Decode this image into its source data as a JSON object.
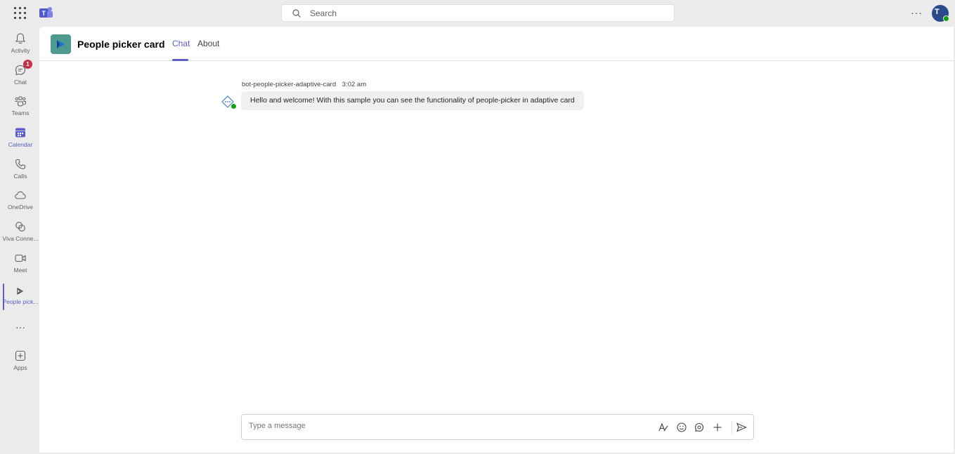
{
  "search": {
    "placeholder": "Search"
  },
  "topbar": {
    "more_label": "···",
    "avatar_initial": "T"
  },
  "rail": {
    "items": [
      {
        "label": "Activity"
      },
      {
        "label": "Chat",
        "badge": "1"
      },
      {
        "label": "Teams"
      },
      {
        "label": "Calendar"
      },
      {
        "label": "Calls"
      },
      {
        "label": "OneDrive"
      },
      {
        "label": "Viva Conne..."
      },
      {
        "label": "Meet"
      },
      {
        "label": "People pick..."
      },
      {
        "label": "Apps"
      }
    ],
    "more_label": "···"
  },
  "header": {
    "title": "People picker card",
    "tabs": [
      {
        "label": "Chat"
      },
      {
        "label": "About"
      }
    ]
  },
  "message": {
    "sender": "bot-people-picker-adaptive-card",
    "time": "3:02 am",
    "text": "Hello and welcome! With this sample you can see the functionality of people-picker in adaptive card"
  },
  "compose": {
    "placeholder": "Type a message"
  },
  "colors": {
    "accent": "#5b5fc7",
    "badge": "#c4314b",
    "presence": "#13a10e"
  }
}
